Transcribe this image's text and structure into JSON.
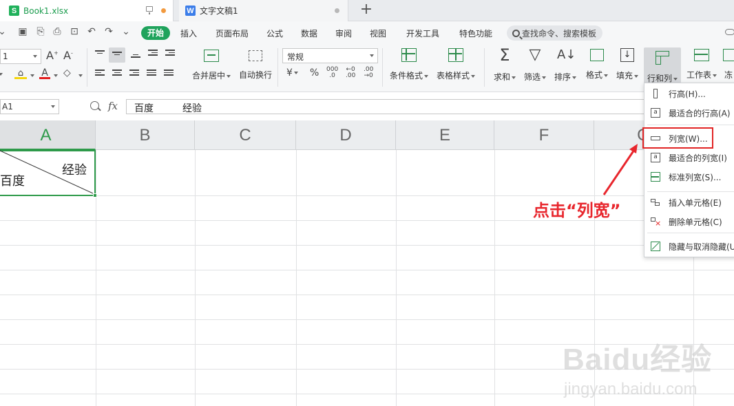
{
  "tabs": [
    {
      "title": "Book1.xlsx",
      "icon": "S"
    },
    {
      "title": "文字文稿1",
      "icon": "W"
    }
  ],
  "new_tab_label": "+",
  "menu": {
    "start": "开始",
    "items": [
      "插入",
      "页面布局",
      "公式",
      "数据",
      "审阅",
      "视图",
      "开发工具",
      "特色功能"
    ],
    "search": "查找命令、搜索模板"
  },
  "ribbon": {
    "font_size": "1",
    "number_format": "常规",
    "merge": "合并居中",
    "wrap": "自动换行",
    "cond_format": "条件格式",
    "table_style": "表格样式",
    "sum": "求和",
    "filter": "筛选",
    "sort": "排序",
    "format": "格式",
    "fill": "填充",
    "row_col": "行和列",
    "worksheet": "工作表",
    "freeze": "冻"
  },
  "formula_bar": {
    "name_box": "A1",
    "fx": "fx",
    "value_left": "百度",
    "value_right": "经验"
  },
  "columns": [
    "A",
    "B",
    "C",
    "D",
    "E",
    "F",
    "G"
  ],
  "cell_a1": {
    "top_right": "经验",
    "bottom_left": "百度"
  },
  "context_menu": {
    "items": [
      {
        "label": "行高(H)...",
        "icon": "row-height-icon"
      },
      {
        "label": "最适合的行高(A)",
        "icon": "autofit-row-icon"
      },
      {
        "label": "列宽(W)...",
        "icon": "column-width-icon"
      },
      {
        "label": "最适合的列宽(I)",
        "icon": "autofit-column-icon"
      },
      {
        "label": "标准列宽(S)...",
        "icon": "standard-width-icon"
      },
      {
        "label": "插入单元格(E)",
        "icon": "insert-cell-icon"
      },
      {
        "label": "删除单元格(C)",
        "icon": "delete-cell-icon"
      },
      {
        "label": "隐藏与取消隐藏(U",
        "icon": "hide-unhide-icon"
      }
    ]
  },
  "annotation": "点击“列宽”",
  "watermark": {
    "logo": "Baidu经验",
    "url": "jingyan.baidu.com"
  },
  "colors": {
    "accent_green": "#1fa35c",
    "highlight_red": "#e12424",
    "annotation_red": "#e8262d"
  }
}
